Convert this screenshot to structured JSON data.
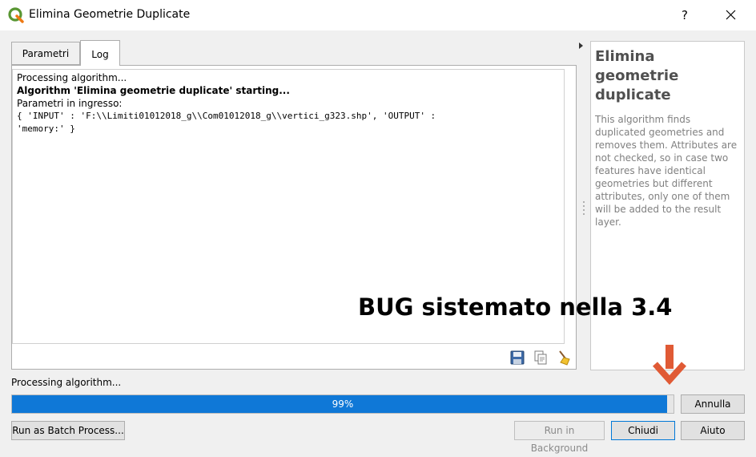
{
  "window": {
    "title": "Elimina Geometrie Duplicate",
    "help_label": "?"
  },
  "tabs": [
    {
      "label": "Parametri",
      "active": false
    },
    {
      "label": "Log",
      "active": true
    }
  ],
  "log": {
    "line1": "Processing algorithm...",
    "line2": "Algorithm 'Elimina geometrie duplicate' starting...",
    "line3": "Parametri in ingresso:",
    "line4": "{ 'INPUT' : 'F:\\\\Limiti01012018_g\\\\Com01012018_g\\\\vertici_g323.shp', 'OUTPUT' :",
    "line5": "'memory:' }"
  },
  "help_panel": {
    "title": "Elimina geometrie duplicate",
    "description": "This algorithm finds duplicated geometries and removes them. Attributes are not checked, so in case two features have identical geometries but different attributes, only one of them will be added to the result layer."
  },
  "status": {
    "text": "Processing algorithm...",
    "progress_value": 99,
    "progress_label": "99%"
  },
  "buttons": {
    "annulla": "Annulla",
    "batch": "Run as Batch Process...",
    "background": "Run in Background",
    "chiudi": "Chiudi",
    "aiuto": "Aiuto"
  },
  "annotation": {
    "text": "BUG sistemato nella 3.4"
  },
  "colors": {
    "progress_fill": "#0f78d7",
    "arrow": "#e05a35",
    "qgis_green": "#589632"
  }
}
